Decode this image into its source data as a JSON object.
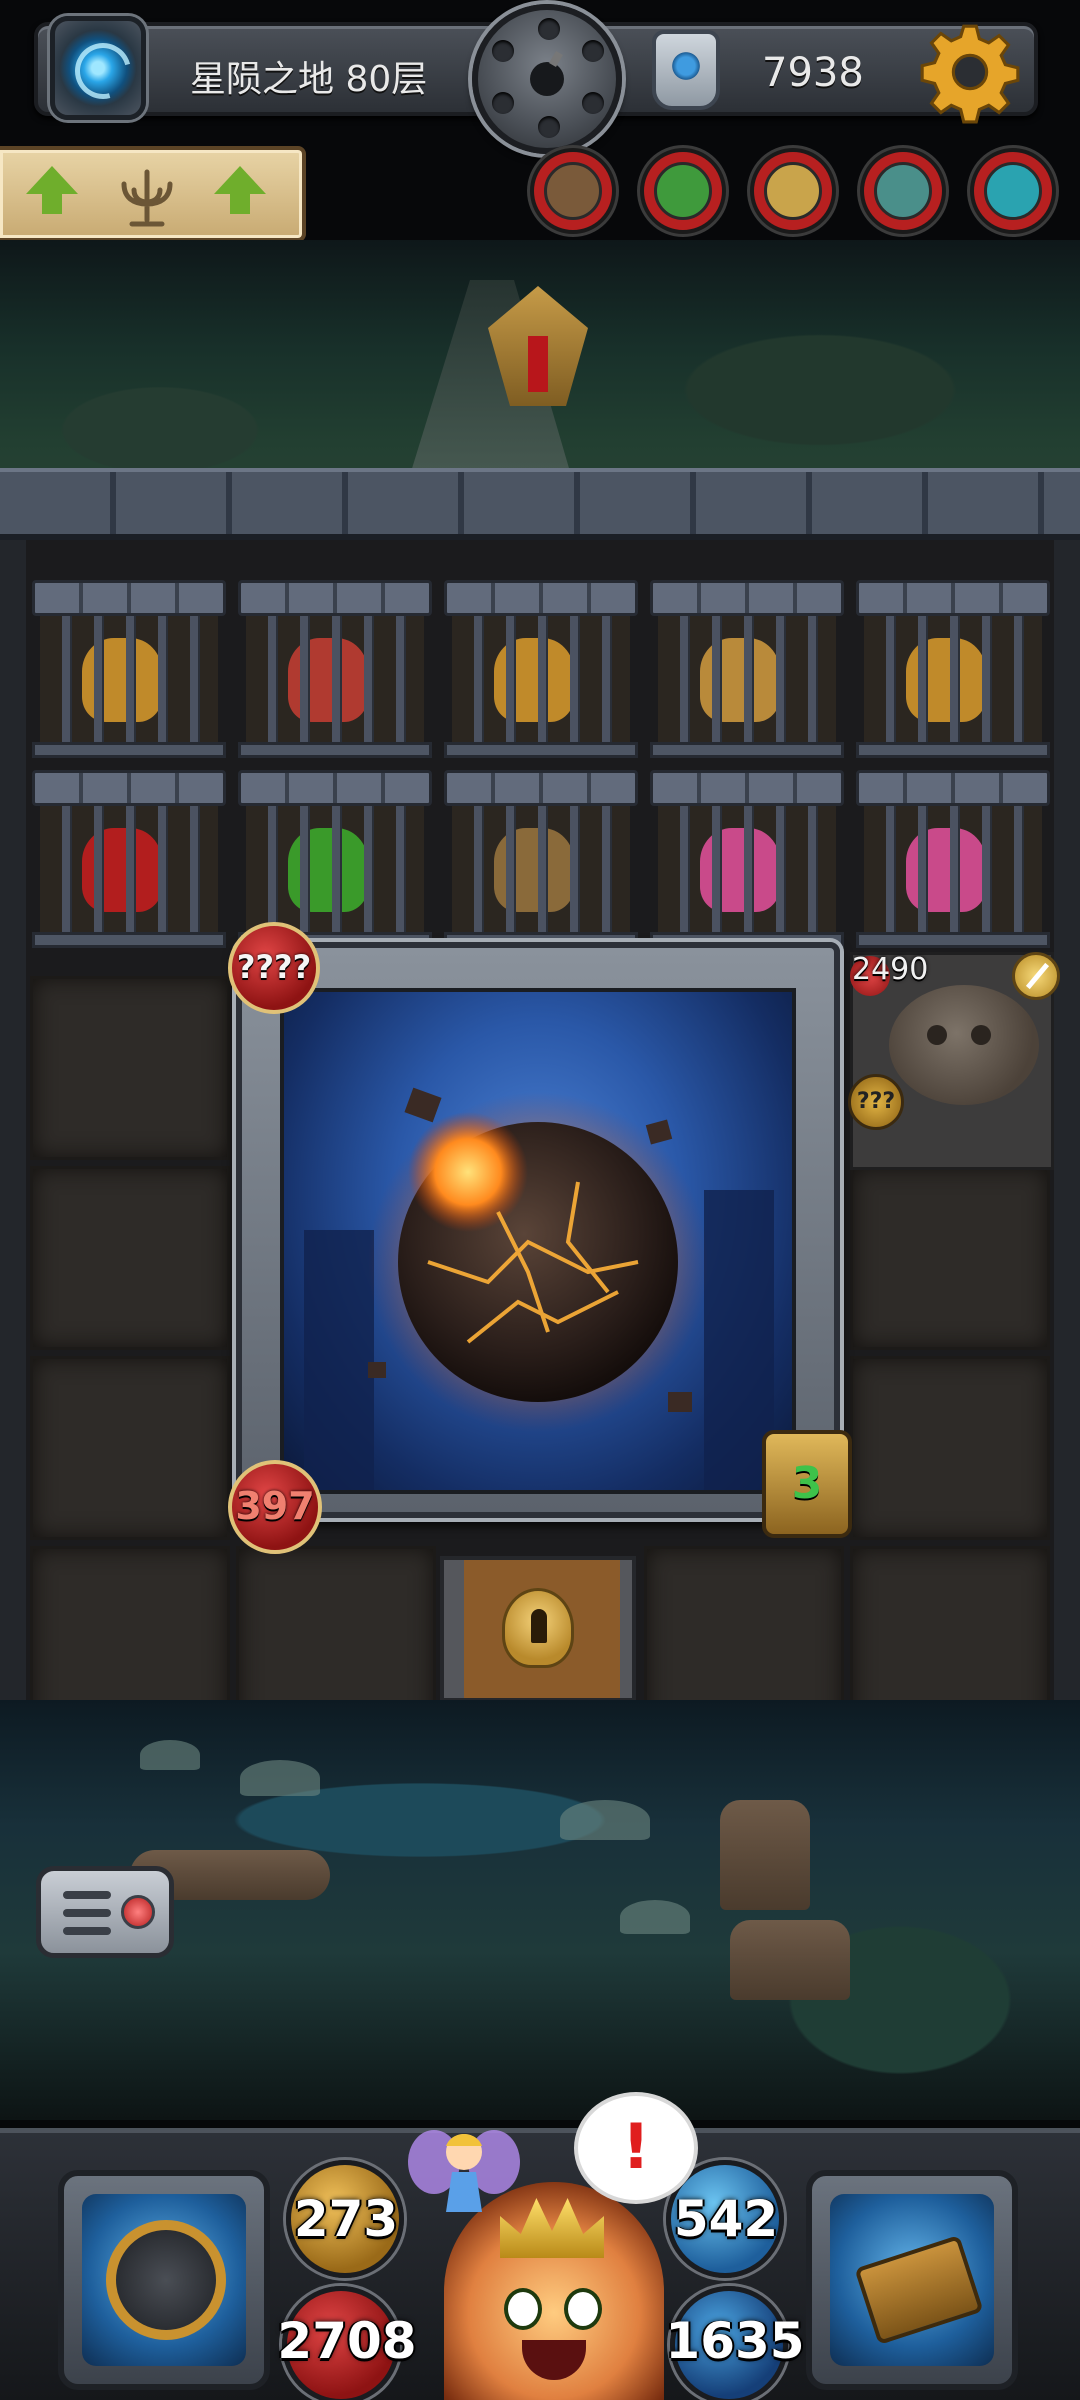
{
  "header": {
    "floor_label": "星陨之地 80层",
    "currency_value": "7938",
    "icons": [
      "portal-icon",
      "bomb-icon",
      "rune-stone-icon",
      "gear-icon"
    ]
  },
  "banner": {
    "icons": [
      "up-arrow-icon",
      "candelabra-icon",
      "up-arrow-icon"
    ]
  },
  "status_effects": [
    {
      "name": "barrel-status-icon",
      "color": "#7a5a3a"
    },
    {
      "name": "green-goblin-status-icon",
      "color": "#3f9a3c"
    },
    {
      "name": "mushroom-status-icon",
      "color": "#c9a44b"
    },
    {
      "name": "teal-beast-status-icon",
      "color": "#4a8f8a"
    },
    {
      "name": "cyan-slime-status-icon",
      "color": "#2aa3b0"
    }
  ],
  "dungeon": {
    "boss": {
      "attack_label": "????",
      "hp_value": "397",
      "timer_value": "3"
    },
    "enemy": {
      "hp_value": "2490",
      "unknown_label": "???"
    }
  },
  "hud": {
    "attack": "273",
    "defense": "542",
    "hp": "2708",
    "mana": "1635",
    "alert": "!"
  },
  "colors": {
    "health_red": "#b72020",
    "mana_blue": "#1e5f9c",
    "gold": "#c9922f",
    "timer_green": "#3ec24a"
  }
}
